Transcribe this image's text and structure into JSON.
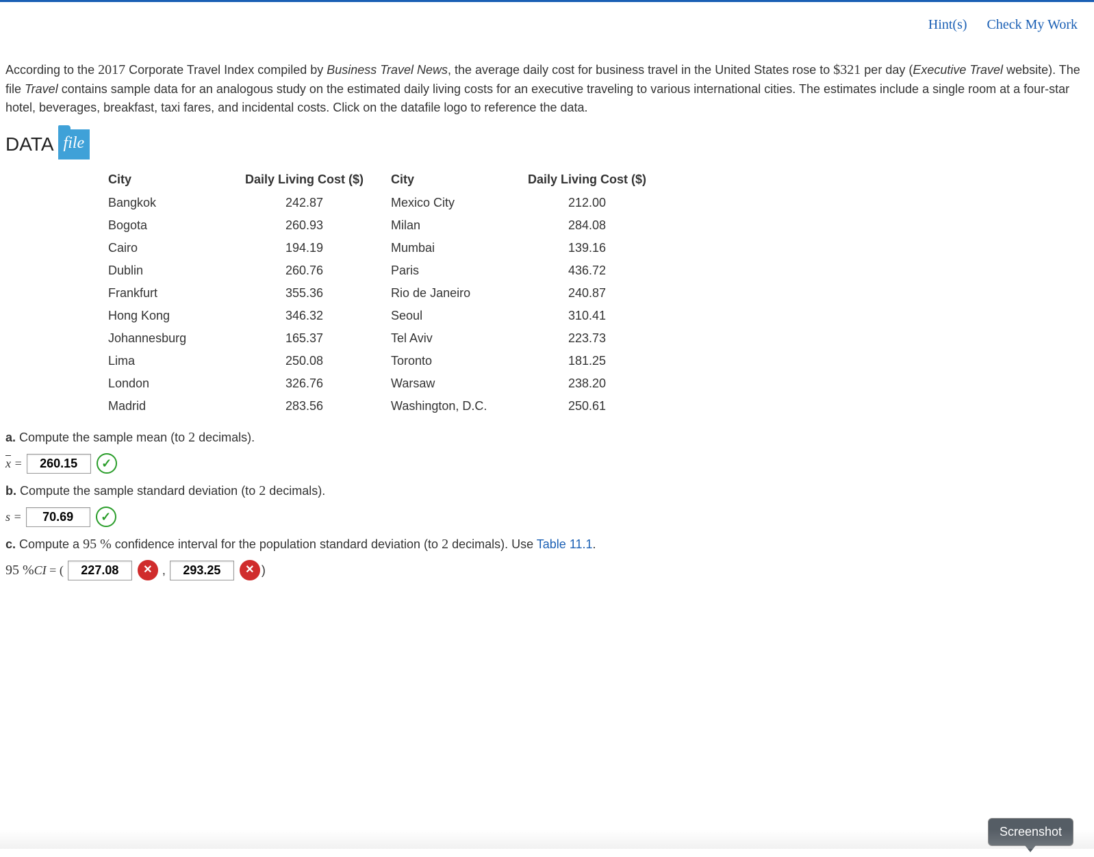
{
  "toplinks": {
    "hints": "Hint(s)",
    "check": "Check My Work"
  },
  "intro": {
    "p1_a": "According to the ",
    "year": "2017",
    "p1_b": " Corporate Travel Index compiled by ",
    "btn": "Business Travel News",
    "p1_c": ", the average daily cost for business travel in the United States rose to ",
    "amount": "$321",
    "p1_d": " per day (",
    "etw": "Executive Travel",
    "p1_e": " website). The file ",
    "travel": "Travel",
    "p1_f": " contains sample data for an analogous study on the estimated daily living costs for an executive traveling to various international cities. The estimates include a single room at a four-star hotel, beverages, breakfast, taxi fares, and incidental costs. Click on the datafile logo to reference the data."
  },
  "datafile": {
    "data": "DATA",
    "file": "file"
  },
  "headers": {
    "city": "City",
    "cost": "Daily Living Cost ($)"
  },
  "rows_left": [
    {
      "city": "Bangkok",
      "cost": "242.87"
    },
    {
      "city": "Bogota",
      "cost": "260.93"
    },
    {
      "city": "Cairo",
      "cost": "194.19"
    },
    {
      "city": "Dublin",
      "cost": "260.76"
    },
    {
      "city": "Frankfurt",
      "cost": "355.36"
    },
    {
      "city": "Hong Kong",
      "cost": "346.32"
    },
    {
      "city": "Johannesburg",
      "cost": "165.37"
    },
    {
      "city": "Lima",
      "cost": "250.08"
    },
    {
      "city": "London",
      "cost": "326.76"
    },
    {
      "city": "Madrid",
      "cost": "283.56"
    }
  ],
  "rows_right": [
    {
      "city": "Mexico City",
      "cost": "212.00"
    },
    {
      "city": "Milan",
      "cost": "284.08"
    },
    {
      "city": "Mumbai",
      "cost": "139.16"
    },
    {
      "city": "Paris",
      "cost": "436.72"
    },
    {
      "city": "Rio de Janeiro",
      "cost": "240.87"
    },
    {
      "city": "Seoul",
      "cost": "310.41"
    },
    {
      "city": "Tel Aviv",
      "cost": "223.73"
    },
    {
      "city": "Toronto",
      "cost": "181.25"
    },
    {
      "city": "Warsaw",
      "cost": "238.20"
    },
    {
      "city": "Washington, D.C.",
      "cost": "250.61"
    }
  ],
  "qa": {
    "a_label": "a.",
    "a_text": " Compute the sample mean (to ",
    "a_num": "2",
    "a_tail": " decimals).",
    "a_prefix": "x̄ =",
    "a_value": "260.15",
    "b_label": "b.",
    "b_text": " Compute the sample standard deviation (to ",
    "b_num": "2",
    "b_tail": " decimals).",
    "b_prefix": "s =",
    "b_value": "70.69",
    "c_label": "c.",
    "c_text": " Compute a ",
    "c_pct": "95 %",
    "c_mid": " confidence interval for the population standard deviation (to ",
    "c_num": "2",
    "c_tail": " decimals). Use ",
    "c_link": "Table 11.1",
    "c_end": ".",
    "c_prefix": "95 %CI = (",
    "c_lo": "227.08",
    "c_comma": ",",
    "c_hi": "293.25",
    "c_close": ")"
  },
  "tooltip": "Screenshot"
}
